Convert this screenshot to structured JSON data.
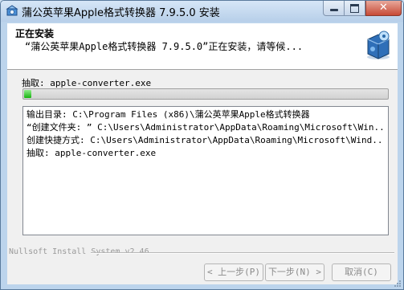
{
  "window": {
    "title": "蒲公英苹果Apple格式转换器 7.9.5.0 安装",
    "close_glyph": "✕"
  },
  "header": {
    "title": "正在安装",
    "subtitle": "“蒲公英苹果Apple格式转换器 7.9.5.0”正在安装，请等候..."
  },
  "status": {
    "current_action": "抽取: apple-converter.exe"
  },
  "progress": {
    "percent": 2
  },
  "log": {
    "lines": [
      "输出目录: C:\\Program Files (x86)\\蒲公英苹果Apple格式转换器",
      "“创建文件夹: ” C:\\Users\\Administrator\\AppData\\Roaming\\Microsoft\\Win...",
      "创建快捷方式: C:\\Users\\Administrator\\AppData\\Roaming\\Microsoft\\Wind...",
      "抽取: apple-converter.exe"
    ]
  },
  "footer": {
    "branding": "Nullsoft Install System v2.46",
    "back_label": "< 上一步(P)",
    "next_label": "下一步(N) >",
    "cancel_label": "取消(C)"
  },
  "icons": {
    "app": "installer-icon",
    "header": "installer-box-icon"
  },
  "colors": {
    "progress_fill": "#17b40f",
    "title_bar": "#c4d8ef",
    "close_button": "#c74a36"
  }
}
